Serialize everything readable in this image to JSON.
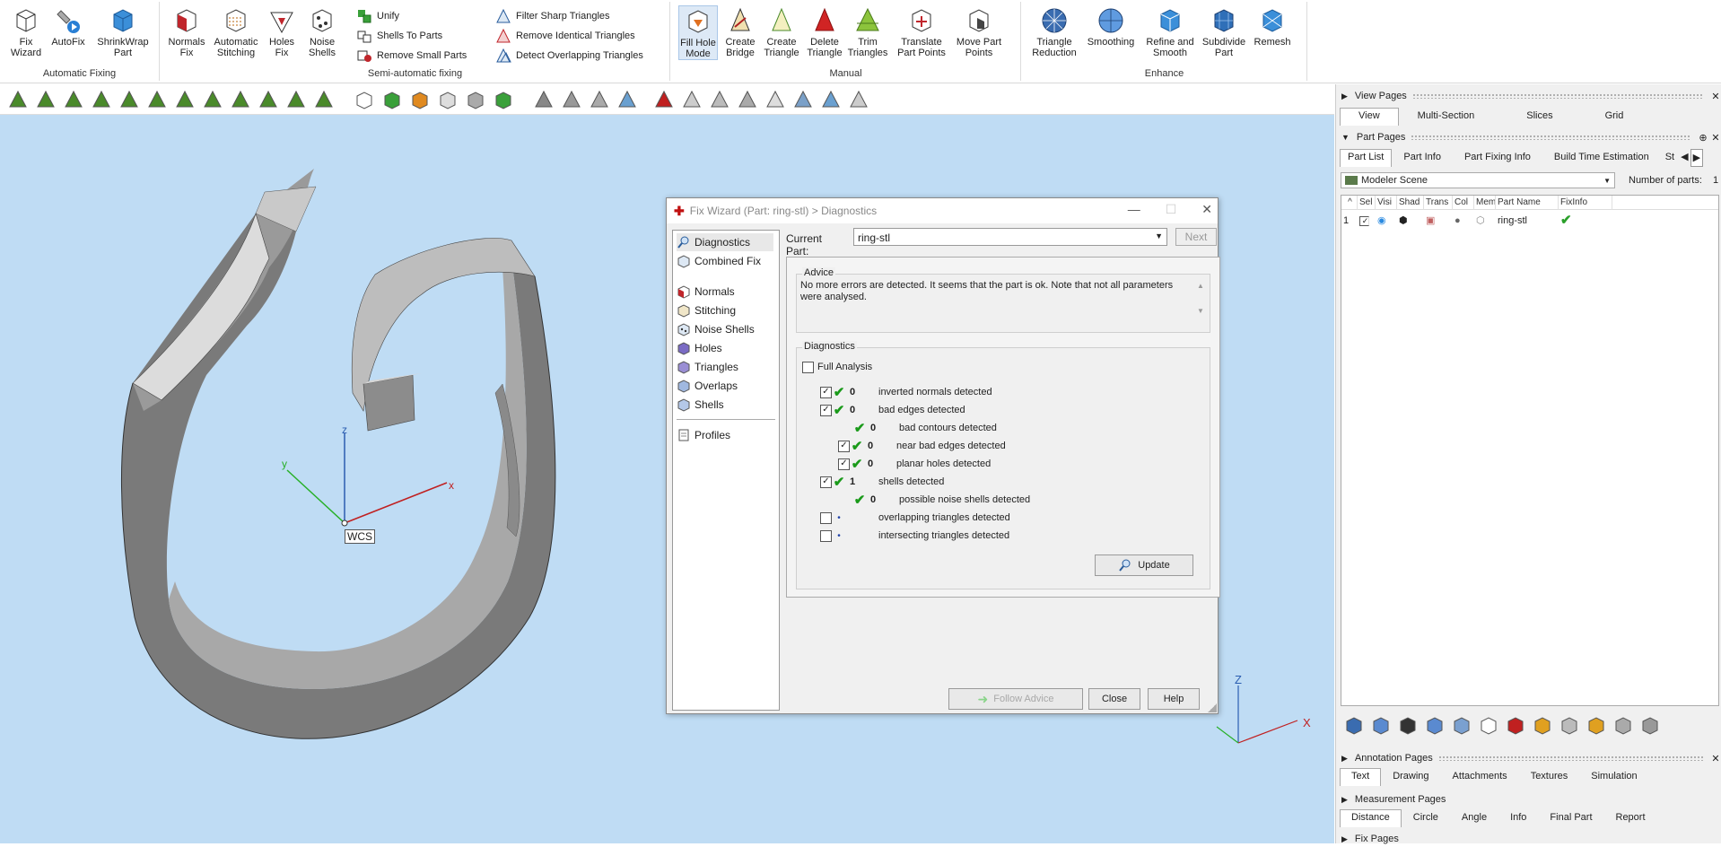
{
  "ribbon": {
    "groups": {
      "automatic": "Automatic Fixing",
      "semi": "Semi-automatic fixing",
      "manual": "Manual",
      "enhance": "Enhance"
    },
    "buttons": {
      "fix_wizard": "Fix\nWizard",
      "autofix": "AutoFix",
      "shrinkwrap": "ShrinkWrap\nPart",
      "normals_fix": "Normals\nFix",
      "auto_stitch": "Automatic\nStitching",
      "holes_fix": "Holes\nFix",
      "noise_shells": "Noise\nShells",
      "unify": "Unify",
      "shells_to_parts": "Shells To Parts",
      "remove_small": "Remove Small Parts",
      "filter_sharp": "Filter Sharp Triangles",
      "remove_identical": "Remove Identical Triangles",
      "detect_overlap": "Detect Overlapping Triangles",
      "fill_hole": "Fill Hole\nMode",
      "create_bridge": "Create\nBridge",
      "create_triangle": "Create\nTriangle",
      "delete_triangle": "Delete\nTriangle",
      "trim_triangles": "Trim\nTriangles",
      "translate_points": "Translate\nPart Points",
      "move_points": "Move Part\nPoints",
      "tri_reduction": "Triangle\nReduction",
      "smoothing": "Smoothing",
      "refine_smooth": "Refine and\nSmooth",
      "subdivide": "Subdivide\nPart",
      "remesh": "Remesh"
    }
  },
  "viewport": {
    "axis_x": "x",
    "axis_y": "y",
    "axis_z": "z",
    "wcs": "WCS",
    "corner_x": "X",
    "corner_z": "Z",
    "background": "#bfdcf4"
  },
  "dialog": {
    "title": "Fix Wizard (Part: ring-stl) > Diagnostics",
    "nav": {
      "diagnostics": "Diagnostics",
      "combined": "Combined Fix",
      "normals": "Normals",
      "stitching": "Stitching",
      "noise": "Noise Shells",
      "holes": "Holes",
      "triangles": "Triangles",
      "overlaps": "Overlaps",
      "shells": "Shells",
      "profiles": "Profiles"
    },
    "current_part_label": "Current Part:",
    "current_part_value": "ring-stl",
    "next": "Next",
    "advice_title": "Advice",
    "advice_text": "No more errors are detected. It seems that the part is ok. Note that not all parameters were analysed.",
    "diagnostics_title": "Diagnostics",
    "full_analysis": "Full Analysis",
    "rows": {
      "inverted": {
        "count": "0",
        "label": "inverted normals detected"
      },
      "bad_edges": {
        "count": "0",
        "label": "bad edges detected"
      },
      "bad_contours": {
        "count": "0",
        "label": "bad contours detected"
      },
      "near_bad": {
        "count": "0",
        "label": "near bad edges detected"
      },
      "planar_holes": {
        "count": "0",
        "label": "planar holes detected"
      },
      "shells": {
        "count": "1",
        "label": "shells detected"
      },
      "noise_shells": {
        "count": "0",
        "label": "possible noise shells detected"
      },
      "overlapping": {
        "label": "overlapping triangles detected"
      },
      "intersecting": {
        "label": "intersecting triangles detected"
      }
    },
    "update": "Update",
    "follow_advice": "Follow Advice",
    "close": "Close",
    "help": "Help"
  },
  "right_panel": {
    "view_pages": "View Pages",
    "view_tabs": [
      "View",
      "Multi-Section",
      "Slices",
      "Grid"
    ],
    "part_pages": "Part Pages",
    "part_tabs": [
      "Part List",
      "Part Info",
      "Part Fixing Info",
      "Build Time Estimation",
      "St"
    ],
    "scene_select": "Modeler Scene",
    "num_parts_label": "Number of parts:",
    "num_parts": "1",
    "columns": [
      "^",
      "Sel",
      "Visi",
      "Shad",
      "Trans",
      "Col",
      "Mem",
      "Part Name",
      "FixInfo"
    ],
    "row_index": "1",
    "row_name": "ring-stl",
    "annotation_pages": "Annotation Pages",
    "annotation_tabs": [
      "Text",
      "Drawing",
      "Attachments",
      "Textures",
      "Simulation"
    ],
    "measurement_pages": "Measurement Pages",
    "measurement_tabs": [
      "Distance",
      "Circle",
      "Angle",
      "Info",
      "Final Part",
      "Report"
    ],
    "fix_pages": "Fix Pages"
  }
}
